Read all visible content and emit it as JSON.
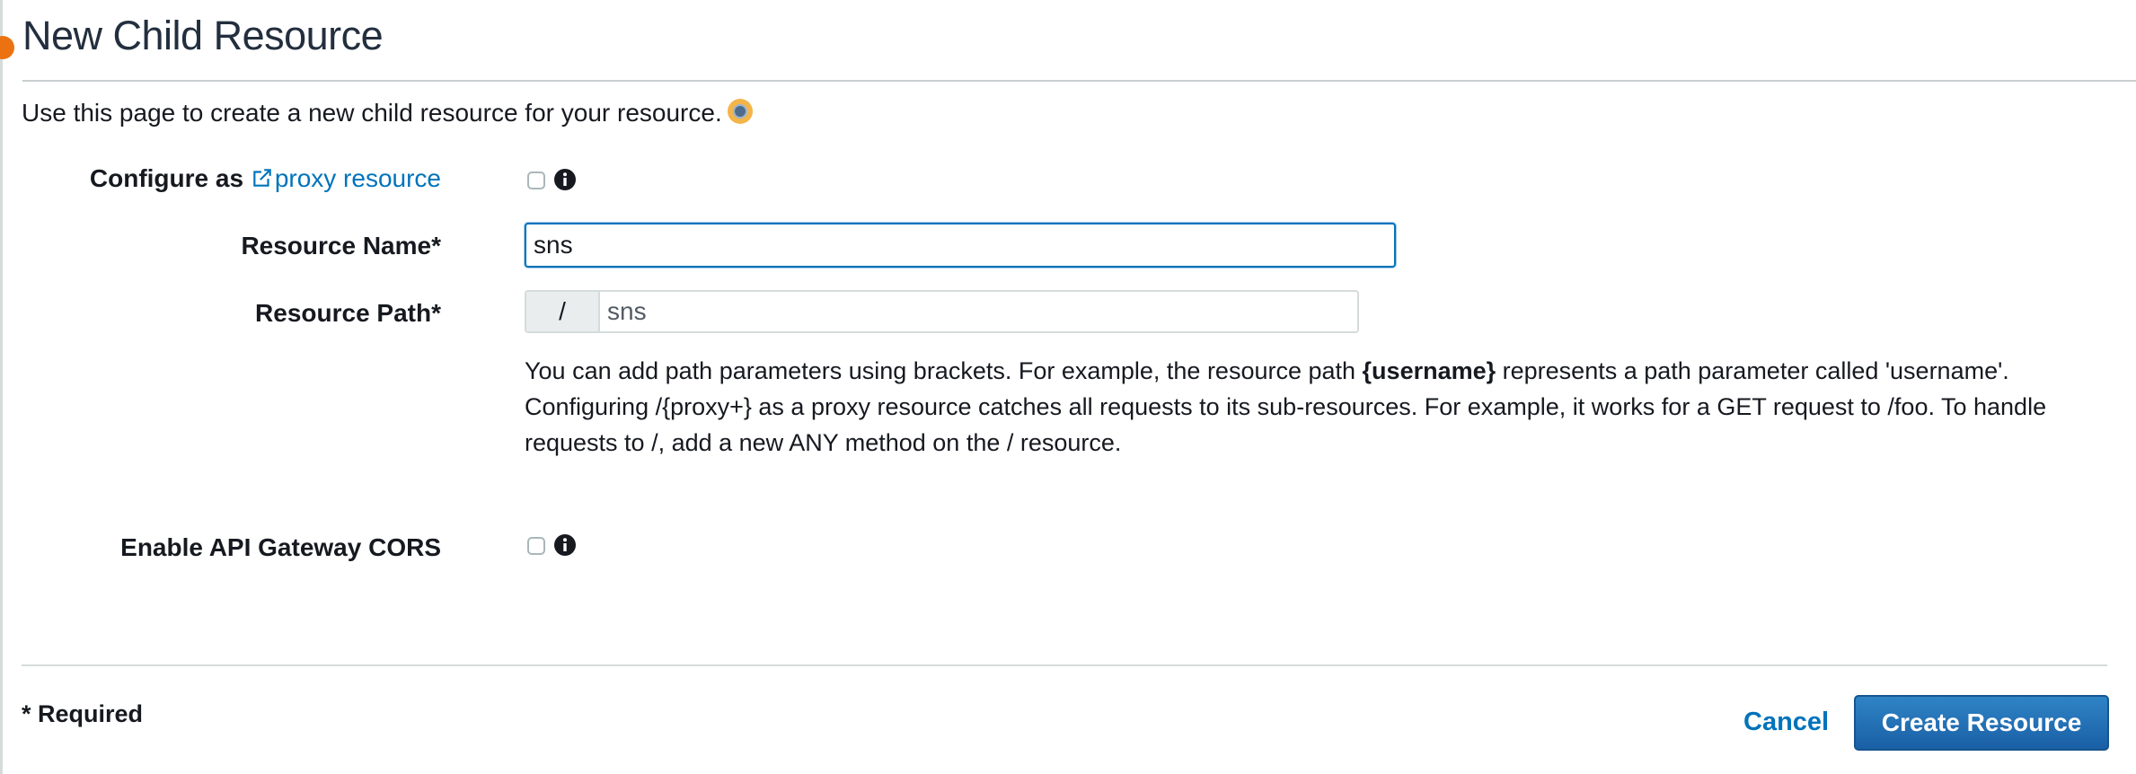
{
  "header": {
    "title": "New Child Resource"
  },
  "intro_text": "Use this page to create a new child resource for your resource.",
  "form": {
    "proxy": {
      "label_prefix": "Configure as",
      "link_text": "proxy resource",
      "checked": false
    },
    "resource_name": {
      "label": "Resource Name*",
      "value": "sns"
    },
    "resource_path": {
      "label": "Resource Path*",
      "prefix": "/",
      "value": "sns"
    },
    "help": {
      "part1": "You can add path parameters using brackets. For example, the resource path ",
      "bold": "{username}",
      "part2": " represents a path parameter called 'username'. Configuring /{proxy+} as a proxy resource catches all requests to its sub-resources. For example, it works for a GET request to /foo. To handle requests to /, add a new ANY method on the / resource."
    },
    "cors": {
      "label": "Enable API Gateway CORS",
      "checked": false
    }
  },
  "footer": {
    "required_note": "* Required",
    "cancel_label": "Cancel",
    "create_label": "Create Resource"
  },
  "icons": {
    "external_link": "external-link-icon",
    "info": "info-icon",
    "help_beacon": "help-beacon-icon"
  },
  "colors": {
    "link": "#0073bb",
    "primary_button": "#1a5fa5",
    "beacon": "#f3b54a",
    "accent_dot": "#ec7211"
  }
}
